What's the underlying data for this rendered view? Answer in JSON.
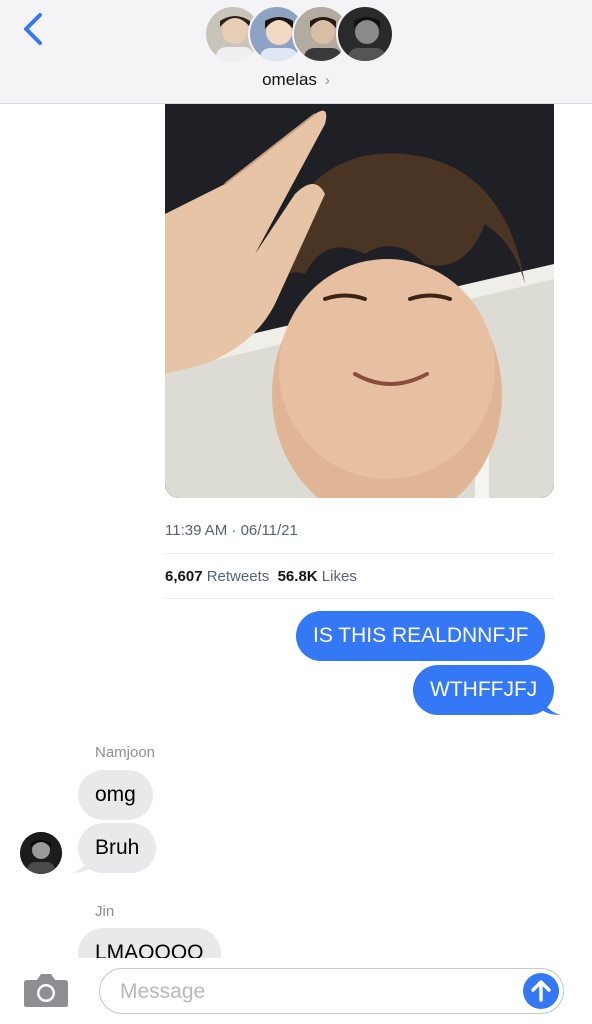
{
  "header": {
    "group_name": "omelas",
    "chevron": "›",
    "back_icon": "chevron-left-icon",
    "accent_color": "#3478f6"
  },
  "tweet": {
    "timestamp": "11:39 AM · 06/11/21",
    "retweets_count": "6,607",
    "retweets_label": "Retweets",
    "likes_count": "56.8K",
    "likes_label": "Likes"
  },
  "messages": {
    "outgoing": [
      {
        "text": "IS THIS REALDNNFJF"
      },
      {
        "text": "WTHFFJFJ"
      }
    ],
    "namjoon": {
      "sender": "Namjoon",
      "messages": [
        {
          "text": "omg"
        },
        {
          "text": "Bruh"
        }
      ]
    },
    "jin": {
      "sender": "Jin",
      "messages": [
        {
          "text": "LMAOOOO"
        }
      ]
    }
  },
  "input": {
    "placeholder": "Message",
    "camera_icon": "camera-icon",
    "send_icon": "arrow-up-icon"
  }
}
